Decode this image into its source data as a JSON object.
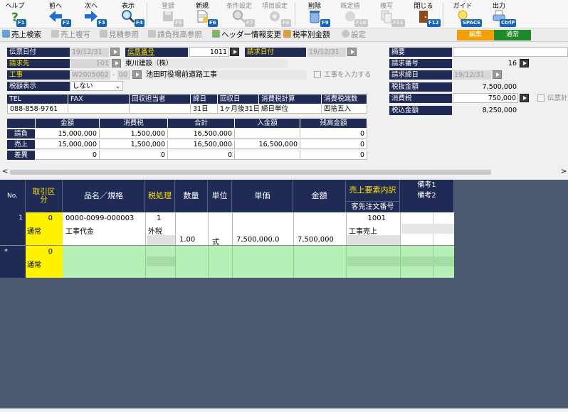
{
  "toolbar": {
    "help": "ヘルプ",
    "prev": "前へ",
    "next": "次へ",
    "view": "表示",
    "register": "登録",
    "new": "新規",
    "cond": "条件設定",
    "item": "項目設定",
    "delete": "削除",
    "default": "既定値",
    "copy": "複写",
    "close": "閉じる",
    "guide": "ガイド",
    "output": "出力",
    "k_f1": "F1",
    "k_f2": "F2",
    "k_f3": "F3",
    "k_f4": "F4",
    "k_f5": "F5",
    "k_f6": "F6",
    "k_f7": "F7",
    "k_f8": "F8",
    "k_f9": "F9",
    "k_f10": "F10",
    "k_f11": "F11",
    "k_f12": "F12",
    "k_space": "SPACE",
    "k_ctrlp": "CtrlP"
  },
  "subbar": {
    "sales_search": "売上検索",
    "sales_copy": "売上複写",
    "estimate_ref": "見積参照",
    "balance_ref": "請負残高参照",
    "header_change": "ヘッダー情報変更",
    "tax_rate_amount": "税率別金額",
    "settings": "設定",
    "mode_edit": "編集",
    "mode_normal": "通常"
  },
  "header": {
    "slip_date_label": "伝票日付",
    "slip_date": "19/12/31",
    "slip_no_label": "伝票番号",
    "slip_no": "1011",
    "bill_date_label": "請求日付",
    "bill_date": "19/12/31",
    "customer_label": "請求先",
    "customer_code": "101",
    "customer_name": "東川建設（株）",
    "project_label": "工事",
    "project_code": "W2005002",
    "project_sep": "-",
    "project_sub": "00",
    "project_name": "池田町役場前道路工事",
    "project_input_check": "工事を入力する",
    "tax_display_label": "税額表示",
    "tax_display": "しない",
    "summary_label": "摘要",
    "summary": "",
    "bill_no_label": "請求番号",
    "bill_no": "16",
    "bill_close_label": "請求締日",
    "bill_close": "19/12/31",
    "pretax_label": "税抜金額",
    "pretax": "7,500,000",
    "tax_label": "消費税",
    "tax": "750,000",
    "slip_total_check": "伝票計",
    "total_label": "税込金額",
    "total": "8,250,000"
  },
  "contact": {
    "headers": [
      "TEL",
      "FAX",
      "回収担当者",
      "締日",
      "回収日",
      "消費税計算",
      "消費税端数"
    ],
    "values": [
      "088-858-9761",
      "",
      "",
      "31日",
      "1ヶ月後31日",
      "締日単位",
      "四捨五入"
    ]
  },
  "summary_table": {
    "headers": [
      "",
      "金額",
      "消費税",
      "合計",
      "入金額",
      "残高金額"
    ],
    "rows": [
      [
        "請負",
        "15,000,000",
        "1,500,000",
        "16,500,000",
        "",
        "0"
      ],
      [
        "売上",
        "15,000,000",
        "1,500,000",
        "16,500,000",
        "16,500,000",
        "0"
      ],
      [
        "差異",
        "0",
        "0",
        "0",
        "",
        "0"
      ]
    ]
  },
  "grid": {
    "h_no": "No.",
    "h_kind": "取引区分",
    "h_name": "品名／規格",
    "h_tax": "税処理",
    "h_qty": "数量",
    "h_unit": "単位",
    "h_price": "単価",
    "h_amount": "金額",
    "h_breakdown": "売上要素内訳",
    "h_order": "客先注文番号",
    "h_note1": "備考1",
    "h_note2": "備考2",
    "row1": {
      "no": "1",
      "kind_code": "0",
      "kind": "通常",
      "code": "0000-0099-000003",
      "name": "工事代金",
      "tax_code": "1",
      "tax": "外税",
      "qty": "1.00",
      "unit": "式",
      "price": "7,500,000.0",
      "amount": "7,500,000",
      "bd_code": "1001",
      "bd_name": "工事売上"
    },
    "new_row": {
      "marker": "*",
      "kind_code": "0",
      "kind": "通常"
    }
  },
  "scroll": {
    "left": "<",
    "right": ">"
  },
  "colors": {
    "navy": "#1f2a55",
    "edit": "#f0a000",
    "normal": "#1f8a2a",
    "new_row": "#b6f0b6"
  }
}
